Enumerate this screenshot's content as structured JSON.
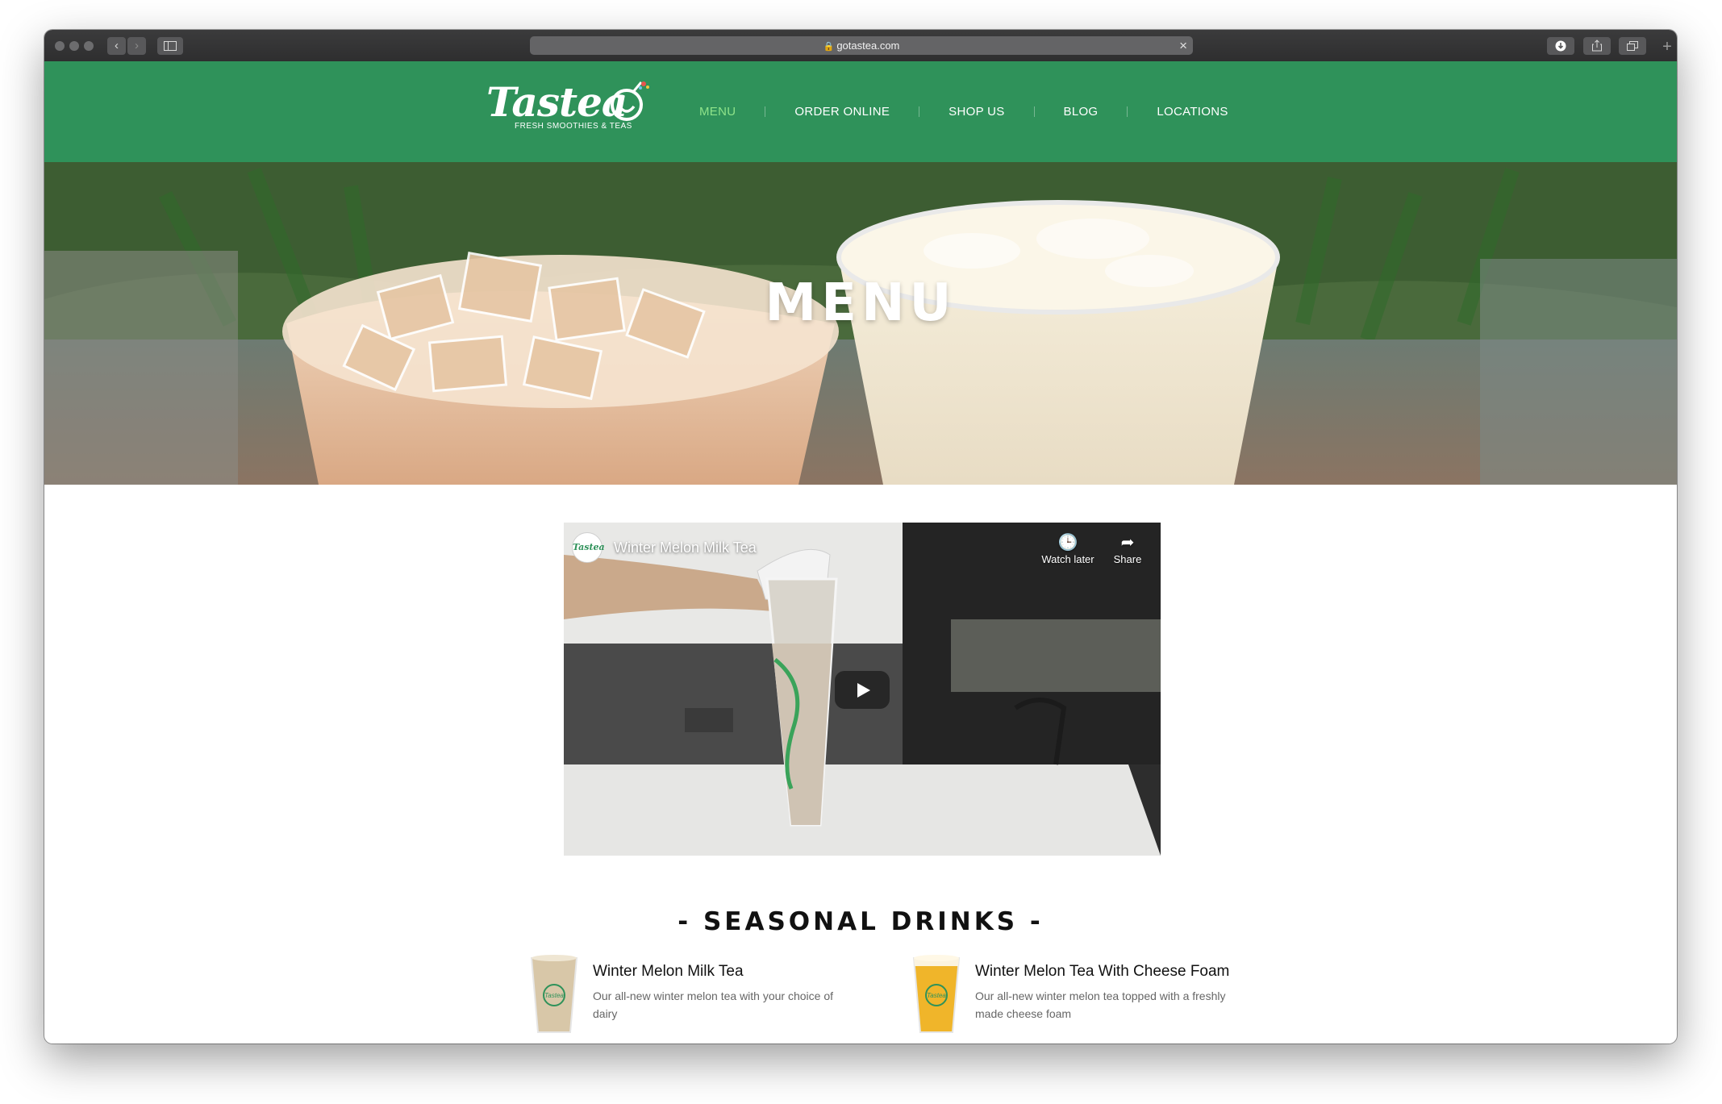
{
  "browser": {
    "url": "gotastea.com",
    "colors": {
      "chrome": "#2e2e2f",
      "address_bar": "#646466"
    },
    "icons": [
      "back-chevron-icon",
      "forward-chevron-icon",
      "sidebar-icon",
      "lock-icon",
      "clear-x-icon",
      "download-icon",
      "share-icon",
      "tabs-icon",
      "new-tab-icon"
    ]
  },
  "site": {
    "logo": {
      "wordmark": "Tastea",
      "tagline": "FRESH SMOOTHIES & TEAS"
    },
    "nav": [
      {
        "label": "MENU",
        "active": true
      },
      {
        "label": "ORDER ONLINE"
      },
      {
        "label": "SHOP US"
      },
      {
        "label": "BLOG"
      },
      {
        "label": "LOCATIONS"
      }
    ],
    "colors": {
      "header": "#2f925a",
      "nav_active": "#8fe38a",
      "nav_text": "#ffffff"
    }
  },
  "hero": {
    "title": "MENU"
  },
  "video": {
    "title": "Winter Melon Milk Tea",
    "channel_icon_text": "Tastea",
    "watch_later": "Watch later",
    "share": "Share",
    "icons": [
      "clock-icon",
      "share-arrow-icon",
      "play-icon"
    ]
  },
  "seasonal": {
    "heading": "- SEASONAL DRINKS -",
    "drinks": [
      {
        "name": "Winter Melon Milk Tea",
        "description": "Our all-new winter melon tea with your choice of dairy",
        "color": "#d8c7a8"
      },
      {
        "name": "Winter Melon Tea With Cheese Foam",
        "description": "Our all-new winter melon tea topped with a freshly made cheese foam",
        "color": "#f0b52a"
      }
    ]
  }
}
